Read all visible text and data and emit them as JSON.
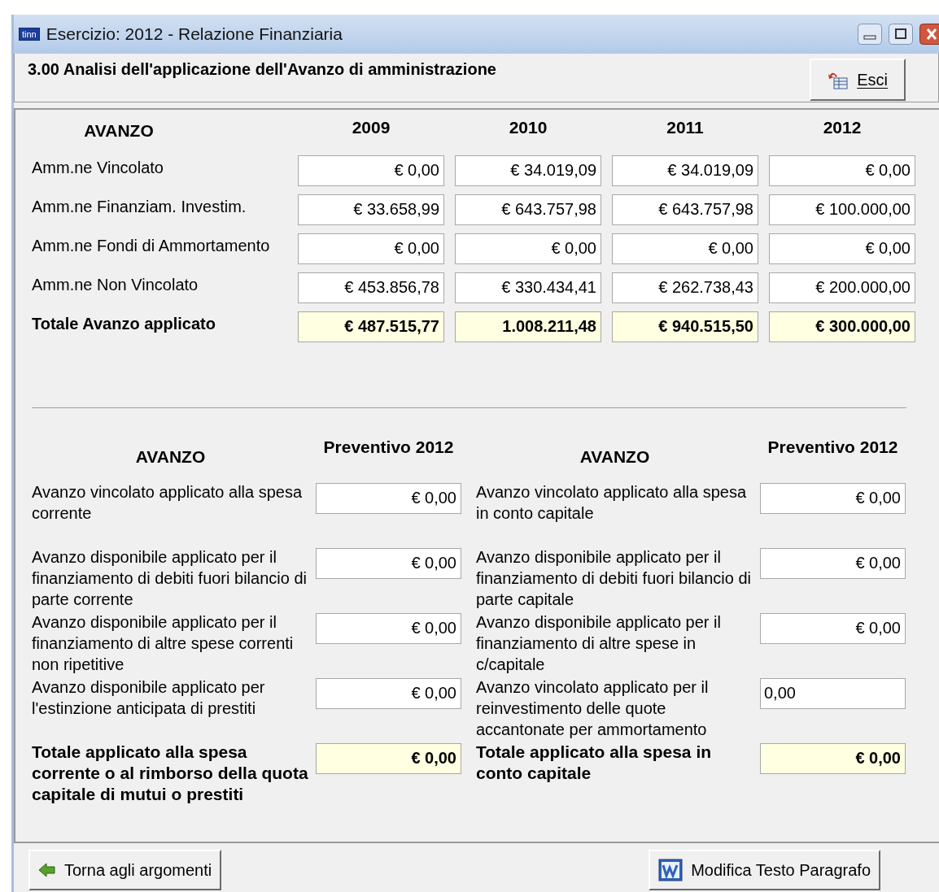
{
  "window": {
    "title": "Esercizio: 2012 - Relazione Finanziaria",
    "app_badge": "tinn"
  },
  "header": {
    "title": "3.00 Analisi dell'applicazione dell'Avanzo di amministrazione",
    "exit_button": "Esci"
  },
  "summary": {
    "label_header": "AVANZO",
    "columns": [
      "2009",
      "2010",
      "2011",
      "2012"
    ],
    "rows": [
      {
        "label": "Amm.ne Vincolato",
        "kind": "normal",
        "values": [
          "€ 0,00",
          "€ 34.019,09",
          "€ 34.019,09",
          "€ 0,00"
        ]
      },
      {
        "label": "Amm.ne Finanziam. Investim.",
        "kind": "normal",
        "values": [
          "€ 33.658,99",
          "€ 643.757,98",
          "€ 643.757,98",
          "€ 100.000,00"
        ]
      },
      {
        "label": "Amm.ne Fondi di Ammortamento",
        "kind": "normal",
        "values": [
          "€ 0,00",
          "€ 0,00",
          "€ 0,00",
          "€ 0,00"
        ]
      },
      {
        "label": "Amm.ne Non Vincolato",
        "kind": "normal",
        "values": [
          "€ 453.856,78",
          "€ 330.434,41",
          "€ 262.738,43",
          "€ 200.000,00"
        ]
      },
      {
        "label": "Totale Avanzo applicato",
        "kind": "total",
        "values": [
          "€ 487.515,77",
          "1.008.211,48",
          "€ 940.515,50",
          "€ 300.000,00"
        ]
      }
    ]
  },
  "detail": [
    {
      "label_header": "AVANZO",
      "value_header": "Preventivo 2012",
      "rows": [
        {
          "label": "Avanzo vincolato applicato alla spesa corrente",
          "kind": "currency",
          "value": "€ 0,00"
        },
        {
          "label": "Avanzo disponibile applicato per il finanziamento di debiti fuori bilancio di parte corrente",
          "kind": "currency",
          "value": "€ 0,00"
        },
        {
          "label": "Avanzo disponibile applicato per il finanziamento di altre spese correnti non ripetitive",
          "kind": "currency",
          "value": "€ 0,00"
        },
        {
          "label": "Avanzo disponibile applicato per l'estinzione anticipata di prestiti",
          "kind": "currency",
          "value": "€ 0,00"
        },
        {
          "label": "Totale applicato alla spesa corrente o al rimborso della quota capitale di mutui o prestiti",
          "kind": "total",
          "value": "€ 0,00"
        }
      ]
    },
    {
      "label_header": "AVANZO",
      "value_header": "Preventivo 2012",
      "rows": [
        {
          "label": "Avanzo vincolato applicato alla spesa in conto capitale",
          "kind": "currency",
          "value": "€ 0,00"
        },
        {
          "label": "Avanzo disponibile applicato per il finanziamento di debiti fuori bilancio di parte capitale",
          "kind": "currency",
          "value": "€ 0,00"
        },
        {
          "label": "Avanzo disponibile applicato per il finanziamento di altre spese in c/capitale",
          "kind": "currency",
          "value": "€ 0,00"
        },
        {
          "label": "Avanzo vincolato applicato per il reinvestimento delle quote accantonate per ammortamento",
          "kind": "text",
          "value": "0,00"
        },
        {
          "label": "Totale applicato alla spesa in conto capitale",
          "kind": "total",
          "value": "€ 0,00"
        }
      ]
    }
  ],
  "footer": {
    "back_button": "Torna agli argomenti",
    "edit_button": "Modifica Testo Paragrafo"
  }
}
